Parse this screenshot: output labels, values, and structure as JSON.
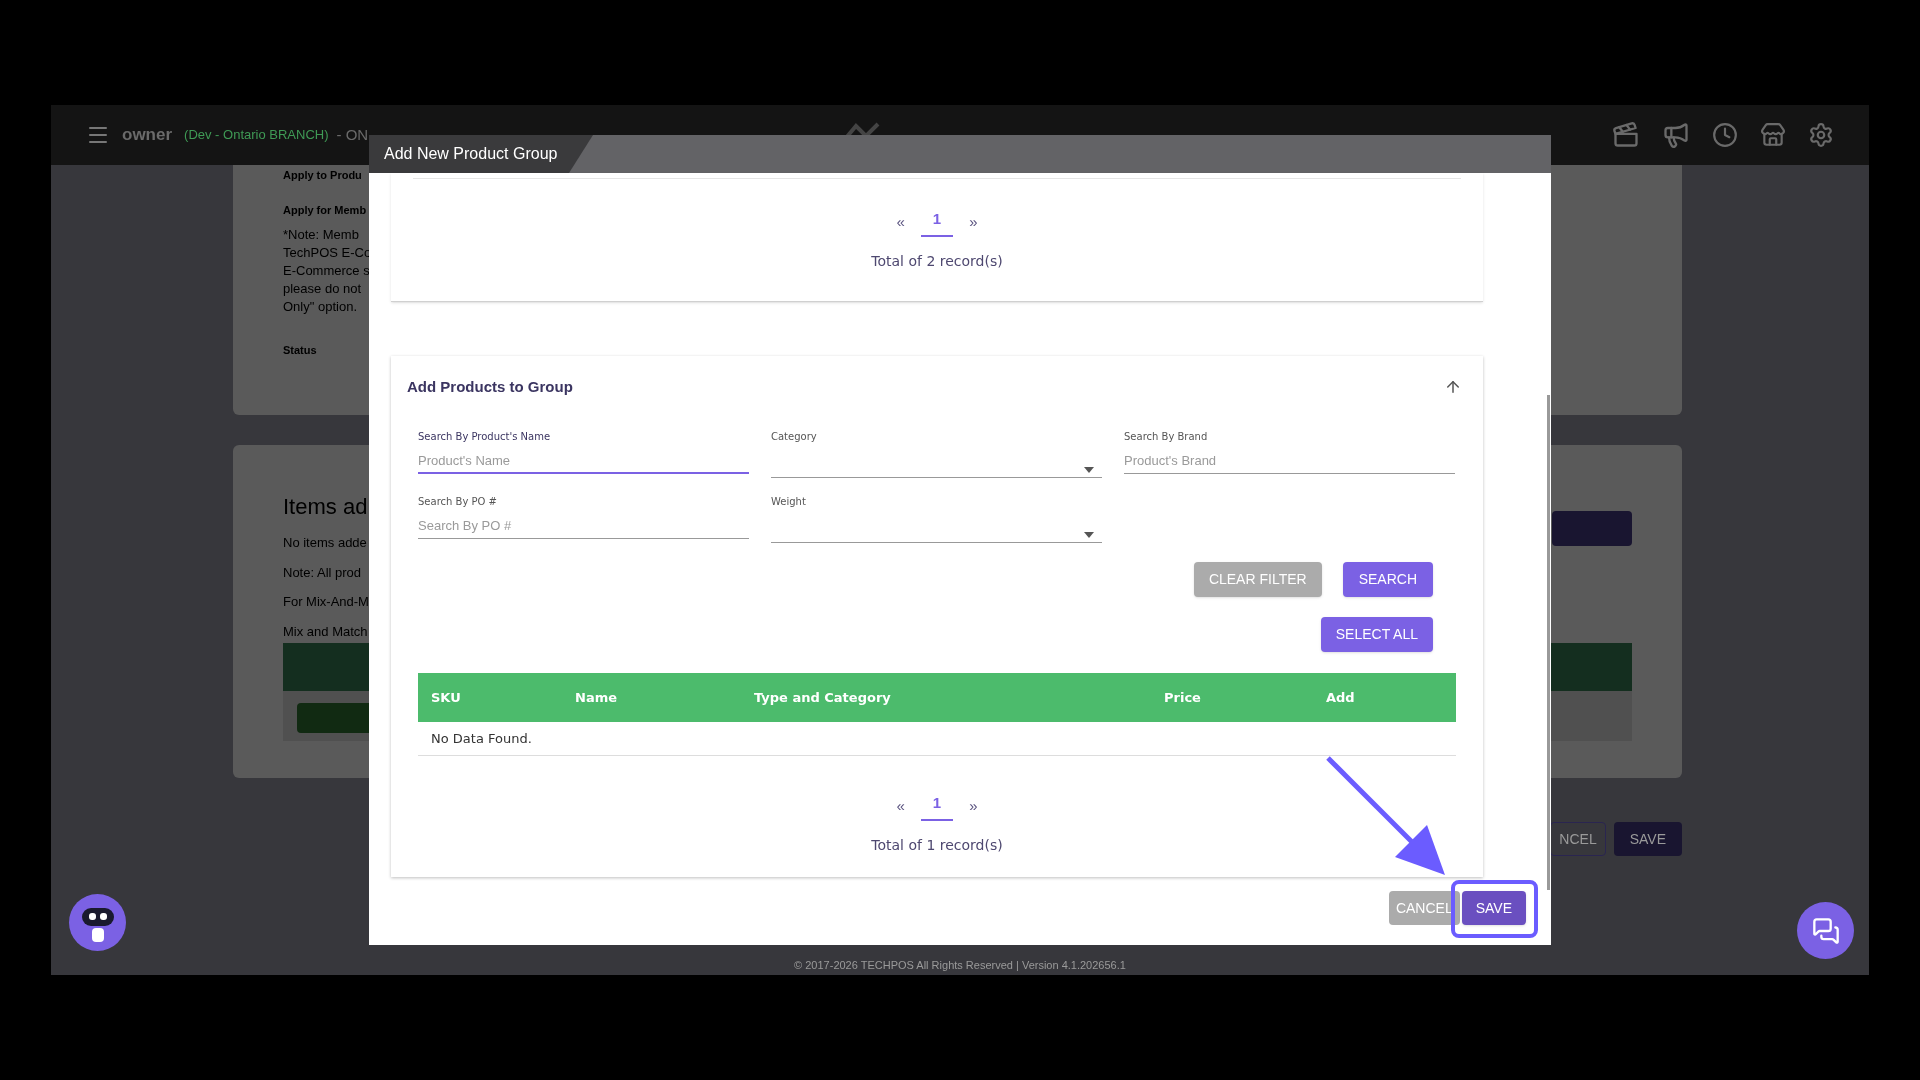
{
  "top_bar": {
    "user": "owner",
    "branch": "(Dev - Ontario BRANCH)",
    "status": "- ON"
  },
  "background": {
    "top_line": "Apply to Produ",
    "card1": [
      {
        "kind": "heading",
        "text": "Apply for Memb"
      },
      {
        "kind": "text",
        "text": "*Note: Memb"
      },
      {
        "kind": "text",
        "text": "TechPOS E-Co"
      },
      {
        "kind": "text",
        "text": "E-Commerce s"
      },
      {
        "kind": "text",
        "text": "please do not"
      },
      {
        "kind": "text",
        "text": "Only\" option."
      },
      {
        "kind": "heading",
        "text": "Status"
      }
    ],
    "card2_title": "Items ad",
    "card2": [
      "No items adde",
      "Note: All prod",
      "For Mix-And-M",
      "Mix and Match"
    ],
    "buttons": [
      {
        "label": "NCEL",
        "kind": "outline"
      },
      {
        "label": "SAVE",
        "kind": "filled"
      }
    ]
  },
  "modal": {
    "title": "Add New Product Group",
    "top_pagination": {
      "prev": "«",
      "next": "»",
      "pages": [
        {
          "label": "1",
          "selected": true
        }
      ],
      "total": "Total of 2 record(s)"
    },
    "section": {
      "title": "Add Products to Group",
      "fields": [
        {
          "label": "Search By Product's Name",
          "placeholder": "Product's Name",
          "kind": "text",
          "focused": true
        },
        {
          "label": "Category",
          "kind": "select",
          "focused": false
        },
        {
          "label": "Search By Brand",
          "placeholder": "Product's Brand",
          "kind": "text",
          "focused": false
        },
        {
          "label": "Search By PO #",
          "placeholder": "Search By PO #",
          "kind": "text",
          "focused": false
        },
        {
          "label": "Weight",
          "kind": "select",
          "focused": false
        }
      ],
      "clear_button": "CLEAR FILTER",
      "search_button": "SEARCH",
      "select_all_button": "SELECT ALL",
      "table": {
        "columns": [
          "SKU",
          "Name",
          "Type and Category",
          "Price",
          "Add"
        ],
        "empty": "No Data Found."
      },
      "pagination": {
        "prev": "«",
        "next": "»",
        "pages": [
          {
            "label": "1",
            "selected": true
          }
        ],
        "total": "Total of 1 record(s)"
      }
    },
    "cancel_button": "CANCEL",
    "save_button": "SAVE"
  },
  "footer": "© 2017-2026 TECHPOS All Rights Reserved | Version 4.1.202656.1"
}
